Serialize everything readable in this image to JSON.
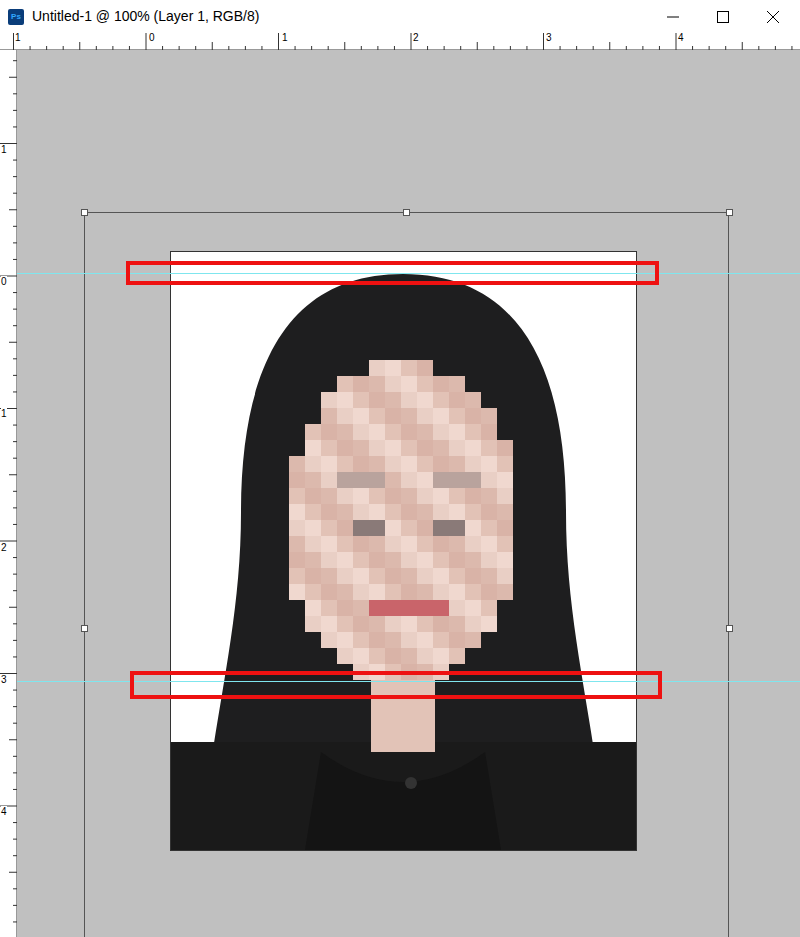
{
  "window": {
    "title": "Untitled-1 @ 100% (Layer 1, RGB/8)",
    "app_icon": "Ps"
  },
  "rulers": {
    "horizontal": [
      "1",
      "0",
      "1",
      "2",
      "3",
      "4"
    ],
    "vertical": [
      "1",
      "0",
      "1",
      "2",
      "3",
      "4"
    ]
  }
}
